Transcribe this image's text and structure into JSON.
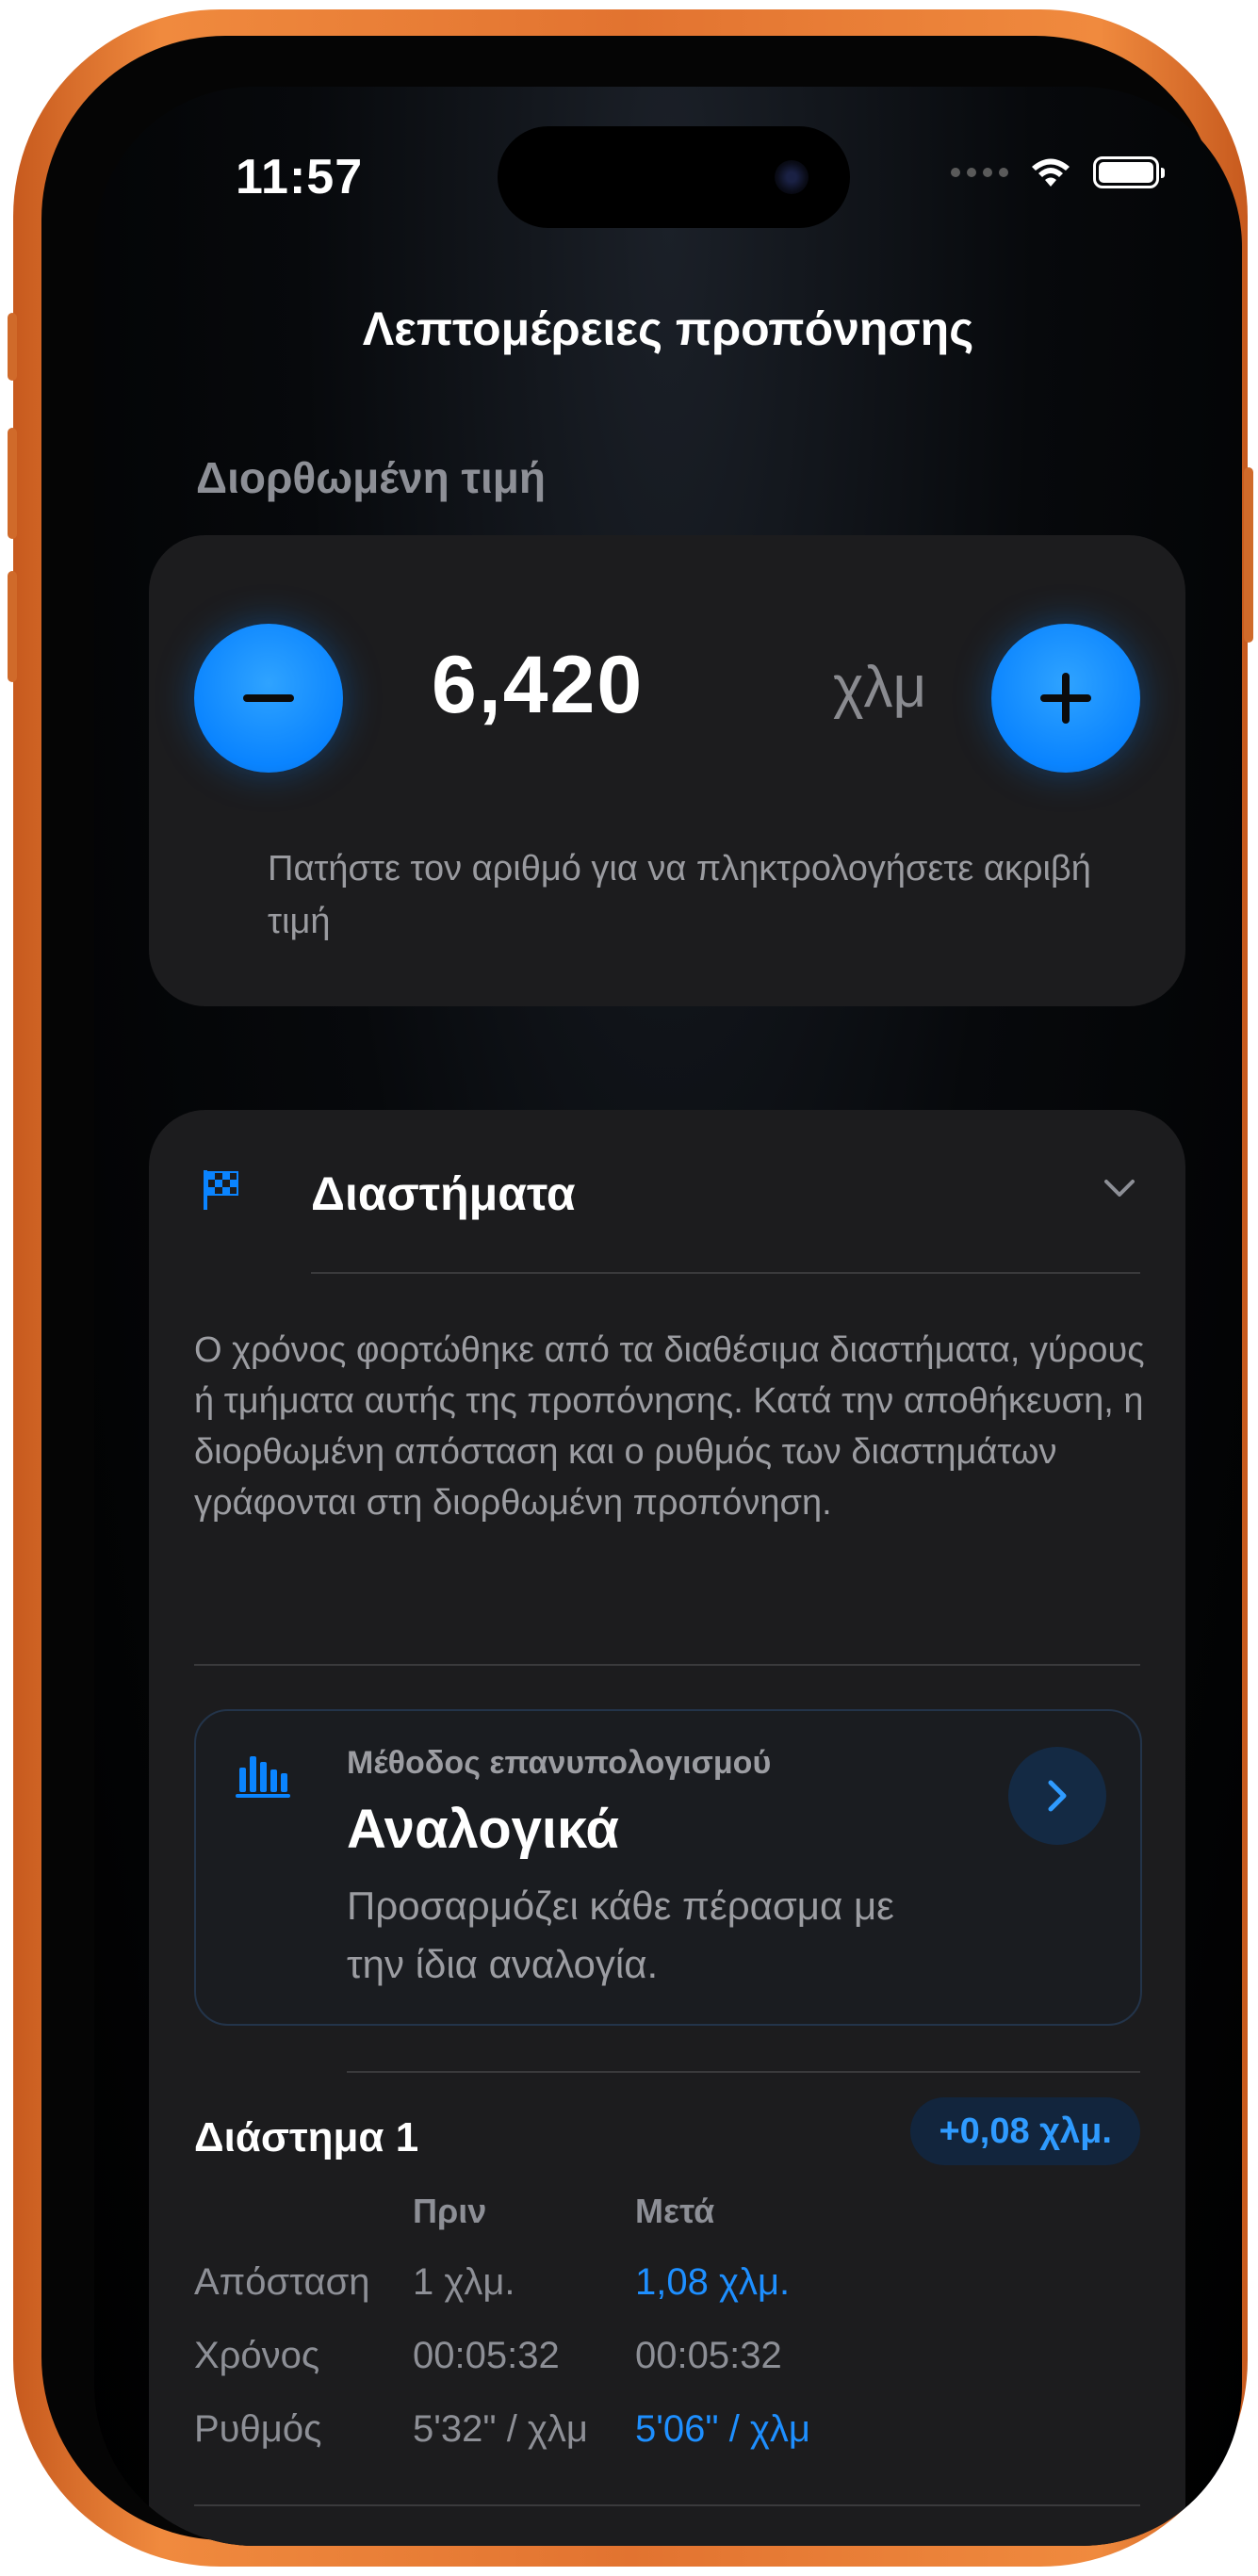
{
  "status_bar": {
    "time": "11:57"
  },
  "header": {
    "title": "Λεπτομέρειες προπόνησης"
  },
  "corrected_value": {
    "section_label": "Διορθωμένη τιμή",
    "value": "6,420",
    "unit": "χλμ",
    "hint": "Πατήστε τον αριθμό για να πληκτρολογήσετε ακριβή τιμή",
    "decrement_icon": "minus-icon",
    "increment_icon": "plus-icon"
  },
  "intervals": {
    "title": "Διαστήματα",
    "description": "Ο χρόνος φορτώθηκε από τα διαθέσιμα διαστήματα, γύρους ή τμήματα αυτής της προπόνησης. Κατά την αποθήκευση, η διορθωμένη απόσταση και ο ρυθμός των διαστημάτων γράφονται στη διορθωμένη προπόνηση.",
    "method": {
      "label": "Μέθοδος επανυπολογισμού",
      "value": "Αναλογικά",
      "description": "Προσαρμόζει κάθε πέρασμα με την ίδια αναλογία."
    },
    "interval_1": {
      "name": "Διάστημα 1",
      "delta": "+0,08 χλμ.",
      "col_before": "Πριν",
      "col_after": "Μετά",
      "rows": [
        {
          "label": "Απόσταση",
          "before": "1 χλμ.",
          "after": "1,08 χλμ.",
          "changed": true
        },
        {
          "label": "Χρόνος",
          "before": "00:05:32",
          "after": "00:05:32",
          "changed": false
        },
        {
          "label": "Ρυθμός",
          "before": "5'32\" / χλμ",
          "after": "5'06\" / χλμ",
          "changed": true
        }
      ]
    }
  },
  "colors": {
    "accent": "#0A84FF",
    "card_bg": "#1C1C1E",
    "frame": "#E27330"
  }
}
